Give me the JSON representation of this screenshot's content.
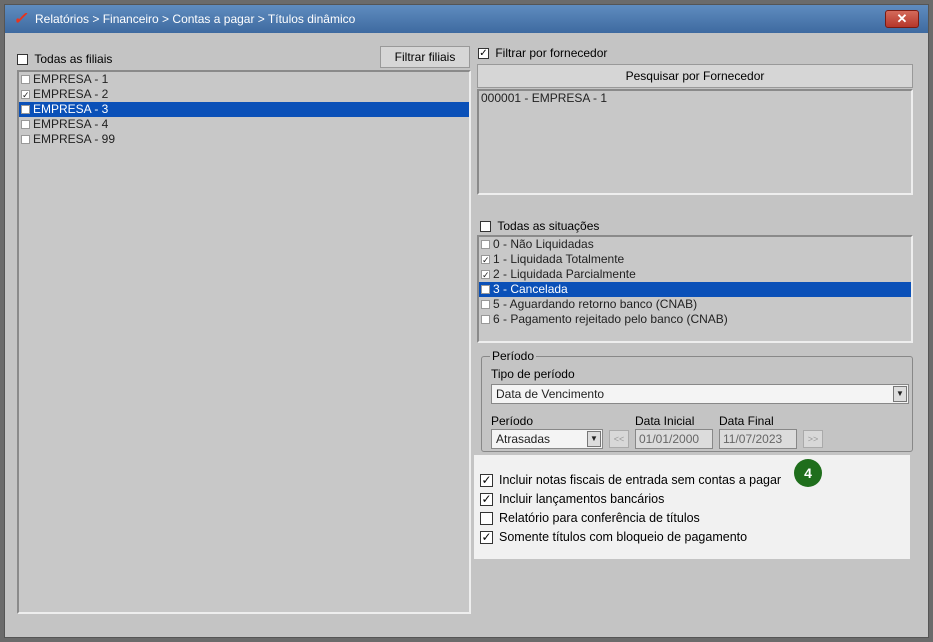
{
  "window": {
    "title": "Relatórios > Financeiro > Contas a pagar > Títulos dinâmico",
    "close_symbol": "✕",
    "logo_glyph": "✓"
  },
  "filiais": {
    "all_label": "Todas as filiais",
    "all_checked": false,
    "filter_button": "Filtrar filiais",
    "items": [
      {
        "label": "EMPRESA - 1",
        "checked": false,
        "selected": false
      },
      {
        "label": "EMPRESA - 2",
        "checked": true,
        "selected": false
      },
      {
        "label": "EMPRESA - 3",
        "checked": true,
        "selected": true
      },
      {
        "label": "EMPRESA - 4",
        "checked": false,
        "selected": false
      },
      {
        "label": "EMPRESA - 99",
        "checked": false,
        "selected": false
      }
    ]
  },
  "fornecedor": {
    "filter_label": "Filtrar por fornecedor",
    "filter_checked": true,
    "search_button": "Pesquisar por Fornecedor",
    "items": [
      "000001 - EMPRESA - 1"
    ]
  },
  "situacoes": {
    "all_label": "Todas as situações",
    "all_checked": false,
    "items": [
      {
        "label": "0 - Não Liquidadas",
        "checked": false,
        "selected": false
      },
      {
        "label": "1 - Liquidada Totalmente",
        "checked": true,
        "selected": false
      },
      {
        "label": "2 - Liquidada Parcialmente",
        "checked": true,
        "selected": false
      },
      {
        "label": "3 - Cancelada",
        "checked": true,
        "selected": true
      },
      {
        "label": "5 - Aguardando retorno banco (CNAB)",
        "checked": false,
        "selected": false
      },
      {
        "label": "6 - Pagamento rejeitado pelo banco (CNAB)",
        "checked": false,
        "selected": false
      }
    ]
  },
  "periodo": {
    "group_label": "Período",
    "tipo_label": "Tipo de período",
    "tipo_value": "Data de Vencimento",
    "periodo_label": "Período",
    "periodo_value": "Atrasadas",
    "data_inicial_label": "Data Inicial",
    "data_inicial_value": "01/01/2000",
    "data_final_label": "Data Final",
    "data_final_value": "11/07/2023",
    "prev_label": "<<",
    "next_label": ">>"
  },
  "options": [
    {
      "label": "Incluir notas fiscais de entrada sem contas a pagar",
      "checked": true
    },
    {
      "label": "Incluir lançamentos bancários",
      "checked": true
    },
    {
      "label": "Relatório para conferência de títulos",
      "checked": false
    },
    {
      "label": "Somente títulos com bloqueio de pagamento",
      "checked": true
    }
  ],
  "step_badge": "4",
  "icons": {
    "logo": "app-logo-icon",
    "close": "close-icon",
    "dropdown": "chevron-down-icon"
  }
}
